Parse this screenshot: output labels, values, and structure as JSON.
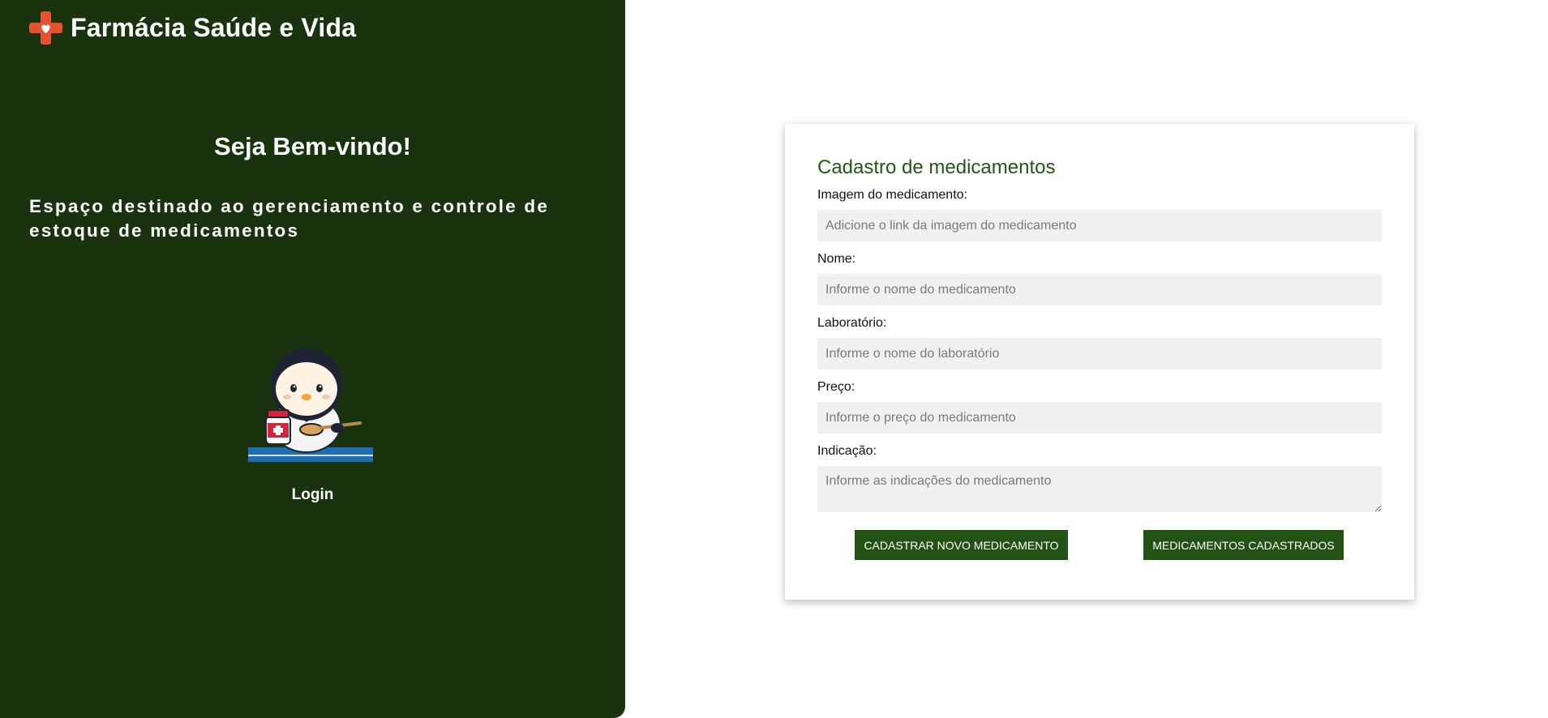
{
  "brand": {
    "name": "Farmácia Saúde e Vida",
    "logo_icon": "cross-heart-icon",
    "logo_color": "#e8512f"
  },
  "sidebar": {
    "welcome": "Seja Bem-vindo!",
    "description": "Espaço destinado ao gerenciamento e controle de estoque de medicamentos",
    "mascot_icon": "penguin-pharmacist-icon",
    "login_label": "Login"
  },
  "form": {
    "title": "Cadastro de medicamentos",
    "fields": {
      "image": {
        "label": "Imagem do medicamento:",
        "placeholder": "Adicione o link da imagem do medicamento",
        "value": ""
      },
      "name": {
        "label": "Nome:",
        "placeholder": "Informe o nome do medicamento",
        "value": ""
      },
      "lab": {
        "label": "Laboratório:",
        "placeholder": "Informe o nome do laboratório",
        "value": ""
      },
      "price": {
        "label": "Preço:",
        "placeholder": "Informe o preço do medicamento",
        "value": ""
      },
      "indication": {
        "label": "Indicação:",
        "placeholder": "Informe as indicações do medicamento",
        "value": ""
      }
    },
    "buttons": {
      "register_new": "CADASTRAR NOVO MEDICAMENTO",
      "registered_list": "MEDICAMENTOS CADASTRADOS"
    }
  },
  "colors": {
    "sidebar_bg": "#18330d",
    "accent_green": "#245214",
    "title_green": "#1f5a13",
    "input_bg": "#f0f0f0"
  }
}
